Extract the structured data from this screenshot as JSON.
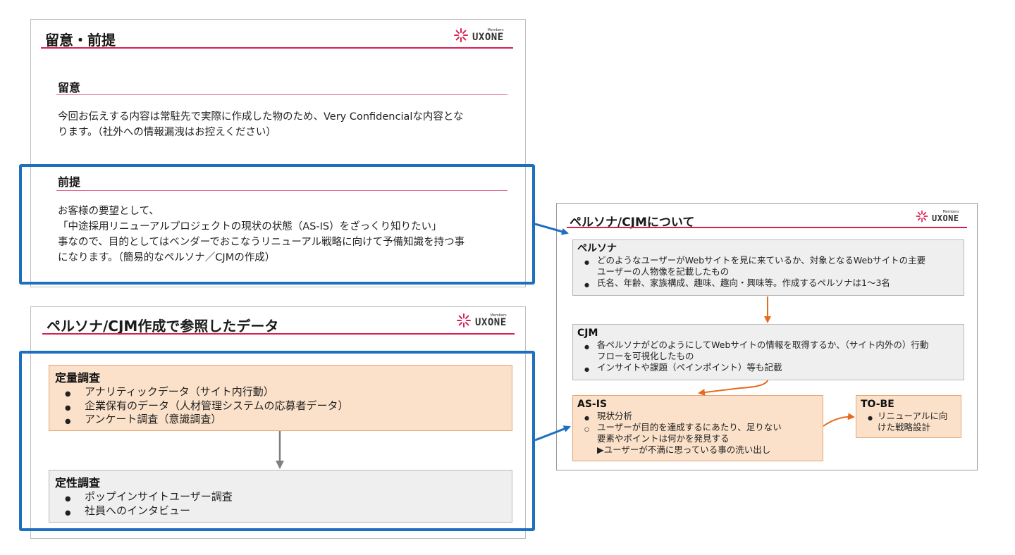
{
  "slide1": {
    "title": "留意・前提",
    "logo": {
      "sub": "Members",
      "name": "UXONE"
    },
    "notice": {
      "heading": "留意",
      "lines": [
        "今回お伝えする内容は常駐先で実際に作成した物のため、Very Confidencialな内容とな",
        "ります。（社外への情報漏洩はお控えください）"
      ]
    },
    "premise": {
      "heading": "前提",
      "lines": [
        "お客様の要望として、",
        "「中途採用リニューアルプロジェクトの現状の状態（AS-IS）をざっくり知りたい」",
        "事なので、目的としてはベンダーでおこなうリニューアル戦略に向けて予備知識を持つ事",
        "になります。（簡易的なペルソナ／CJMの作成）"
      ]
    }
  },
  "slide2": {
    "title": "ペルソナ/CJM作成で参照したデータ",
    "logo": {
      "sub": "Members",
      "name": "UXONE"
    },
    "quant": {
      "title": "定量調査",
      "items": [
        "アナリティックデータ（サイト内行動）",
        "企業保有のデータ（人材管理システムの応募者データ）",
        "アンケート調査（意識調査）"
      ]
    },
    "qual": {
      "title": "定性調査",
      "items": [
        "ポップインサイトユーザー調査",
        "社員へのインタビュー"
      ]
    }
  },
  "slide3": {
    "title": "ペルソナ/CJMについて",
    "logo": {
      "sub": "Members",
      "name": "UXONE"
    },
    "persona": {
      "title": "ペルソナ",
      "items": [
        [
          "どのようなユーザーがWebサイトを見に来ているか、対象となるWebサイトの主要",
          "ユーザーの人物像を記載したもの"
        ],
        [
          "氏名、年齢、家族構成、趣味、趣向・興味等。作成するペルソナは1〜3名"
        ]
      ]
    },
    "cjm": {
      "title": "CJM",
      "items": [
        [
          "各ペルソナがどのようにしてWebサイトの情報を取得するか、（サイト内外の）行動",
          "フローを可視化したもの"
        ],
        [
          "インサイトや課題（ペインポイント）等も記載"
        ]
      ]
    },
    "asis": {
      "title": "AS-IS",
      "item": "現状分析",
      "sub": [
        "ユーザーが目的を達成するにあたり、足りない",
        "要素やポイントは何かを発見する",
        "▶ユーザーが不満に思っている事の洗い出し"
      ]
    },
    "tobe": {
      "title": "TO-BE",
      "item": [
        "リニューアルに向",
        "けた戦略設計"
      ]
    }
  },
  "colors": {
    "accent": "#d6204f",
    "highlight": "#1f6fbf",
    "flow_arrow": "#e86a1c",
    "gray_arrow": "#808080",
    "orange_fill": "#fbe1c9",
    "gray_fill": "#efefef"
  }
}
